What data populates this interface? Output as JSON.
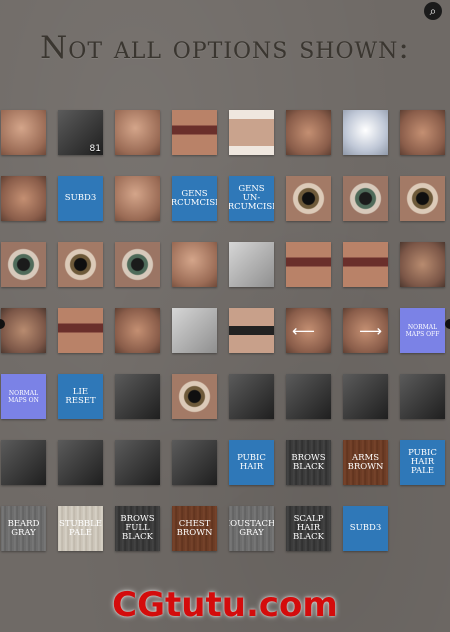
{
  "title": "Not all options shown:",
  "row1_tile2_number": "81",
  "labels": {
    "subd3_a": "SUBD3",
    "gens": "GENS",
    "circumcised": "CIRCUMCISED",
    "uncircumcised": "UN-CIRCUMCISED",
    "normal_maps_off": "NORMAL MAPS OFF",
    "normal_maps_on": "NORMAL MAPS ON",
    "lie_reset": "LIE RESET",
    "pubic_hair": "PUBIC HAIR",
    "brows_black": "BROWS BLACK",
    "arms_brown": "ARMS BROWN",
    "pubic_hair_pale": "PUBIC HAIR PALE",
    "beard_gray": "BEARD GRAY",
    "stubble_pale": "STUBBLE PALE",
    "brows_full_black": "BROWS FULL BLACK",
    "chest_brown": "CHEST BROWN",
    "moustache": "MOUSTACHE",
    "gray": "GRAY",
    "scalp_hair_black": "SCALP HAIR BLACK",
    "subd3_b": "SUBD3"
  },
  "watermark": "CGtutu.com",
  "colors": {
    "background": "#6f6a66",
    "title": "#3a3630",
    "blue_tile": "#2f78b8",
    "lavender_tile": "#7b82e6",
    "watermark": "#d40c0c"
  },
  "icons": {
    "zoom": "zoom-icon",
    "arrow_left": "arrow-left-icon",
    "arrow_right": "arrow-right-icon"
  }
}
